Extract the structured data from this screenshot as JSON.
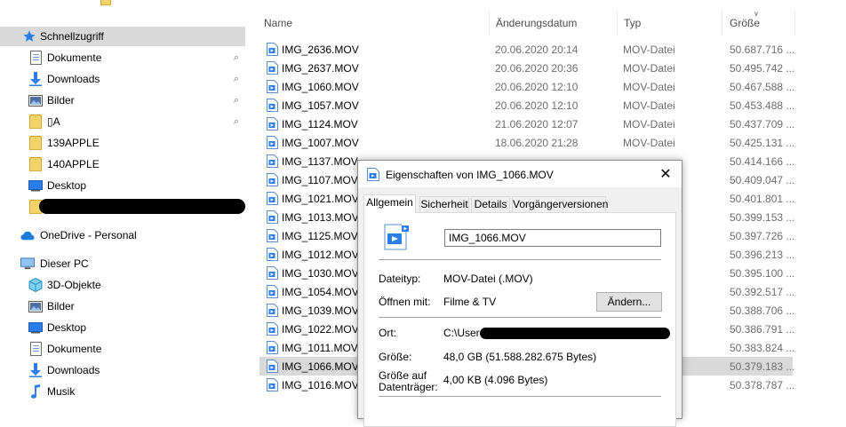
{
  "sidebar": {
    "quick_access": "Schnellzugriff",
    "items": [
      {
        "label": "Dokumente",
        "icon": "document-icon",
        "pinned": true
      },
      {
        "label": "Downloads",
        "icon": "download-arrow-icon",
        "pinned": true
      },
      {
        "label": "Bilder",
        "icon": "pictures-icon",
        "pinned": true
      },
      {
        "label": "▯A",
        "icon": "folder-icon",
        "pinned": true
      },
      {
        "label": "139APPLE",
        "icon": "folder-icon",
        "pinned": false
      },
      {
        "label": "140APPLE",
        "icon": "folder-icon",
        "pinned": false
      },
      {
        "label": "Desktop",
        "icon": "desktop-icon",
        "pinned": false
      }
    ],
    "onedrive": "OneDrive - Personal",
    "this_pc": "Dieser PC",
    "pc_items": [
      {
        "label": "3D-Objekte",
        "icon": "3d-objects-icon"
      },
      {
        "label": "Bilder",
        "icon": "pictures-icon"
      },
      {
        "label": "Desktop",
        "icon": "desktop-icon"
      },
      {
        "label": "Dokumente",
        "icon": "document-icon"
      },
      {
        "label": "Downloads",
        "icon": "download-arrow-icon"
      },
      {
        "label": "Musik",
        "icon": "music-note-icon"
      }
    ]
  },
  "columns": {
    "name": "Name",
    "date": "Änderungsdatum",
    "type": "Typ",
    "size": "Größe"
  },
  "files": [
    {
      "name": "IMG_2636.MOV",
      "date": "20.06.2020 20:14",
      "type": "MOV-Datei",
      "size": "50.687.716 ..."
    },
    {
      "name": "IMG_2637.MOV",
      "date": "20.06.2020 20:36",
      "type": "MOV-Datei",
      "size": "50.495.742 ..."
    },
    {
      "name": "IMG_1060.MOV",
      "date": "20.06.2020 12:10",
      "type": "MOV-Datei",
      "size": "50.467.588 ..."
    },
    {
      "name": "IMG_1057.MOV",
      "date": "20.06.2020 12:10",
      "type": "MOV-Datei",
      "size": "50.453.488 ..."
    },
    {
      "name": "IMG_1124.MOV",
      "date": "21.06.2020 12:07",
      "type": "MOV-Datei",
      "size": "50.437.709 ..."
    },
    {
      "name": "IMG_1007.MOV",
      "date": "18.06.2020 21:28",
      "type": "MOV-Datei",
      "size": "50.425.131 ..."
    },
    {
      "name": "IMG_1137.MOV",
      "date": "",
      "type": "",
      "size": "50.414.166 ..."
    },
    {
      "name": "IMG_1107.MOV",
      "date": "",
      "type": "",
      "size": "50.409.047 ..."
    },
    {
      "name": "IMG_1021.MOV",
      "date": "",
      "type": "",
      "size": "50.401.801 ..."
    },
    {
      "name": "IMG_1013.MOV",
      "date": "",
      "type": "",
      "size": "50.399.153 ..."
    },
    {
      "name": "IMG_1125.MOV",
      "date": "",
      "type": "",
      "size": "50.397.726 ..."
    },
    {
      "name": "IMG_1012.MOV",
      "date": "",
      "type": "",
      "size": "50.396.213 ..."
    },
    {
      "name": "IMG_1030.MOV",
      "date": "",
      "type": "",
      "size": "50.395.100 ..."
    },
    {
      "name": "IMG_1054.MOV",
      "date": "",
      "type": "",
      "size": "50.392.517 ..."
    },
    {
      "name": "IMG_1039.MOV",
      "date": "",
      "type": "",
      "size": "50.388.706 ..."
    },
    {
      "name": "IMG_1022.MOV",
      "date": "",
      "type": "",
      "size": "50.386.791 ..."
    },
    {
      "name": "IMG_1011.MOV",
      "date": "",
      "type": "",
      "size": "50.383.824 ..."
    },
    {
      "name": "IMG_1066.MOV",
      "date": "",
      "type": "",
      "size": "50.379.183 ...",
      "selected": true
    },
    {
      "name": "IMG_1016.MOV",
      "date": "",
      "type": "",
      "size": "50.378.787 ..."
    }
  ],
  "dialog": {
    "title": "Eigenschaften von IMG_1066.MOV",
    "tabs": [
      "Allgemein",
      "Sicherheit",
      "Details",
      "Vorgängerversionen"
    ],
    "filename": "IMG_1066.MOV",
    "dateityp_label": "Dateityp:",
    "dateityp_value": "MOV-Datei (.MOV)",
    "oeffnen_label": "Öffnen mit:",
    "oeffnen_value": "Filme & TV",
    "change_button": "Ändern...",
    "ort_label": "Ort:",
    "ort_value": "C:\\User",
    "groesse_label": "Größe:",
    "groesse_value": "48,0 GB (51.588.282.675 Bytes)",
    "groesse_auf_label_1": "Größe auf",
    "groesse_auf_label_2": "Datenträger:",
    "groesse_auf_value": "4,00 KB (4.096 Bytes)"
  },
  "colors": {
    "selection": "#d9d9d9",
    "accent": "#0078d7",
    "folder": "#f6d36b"
  }
}
